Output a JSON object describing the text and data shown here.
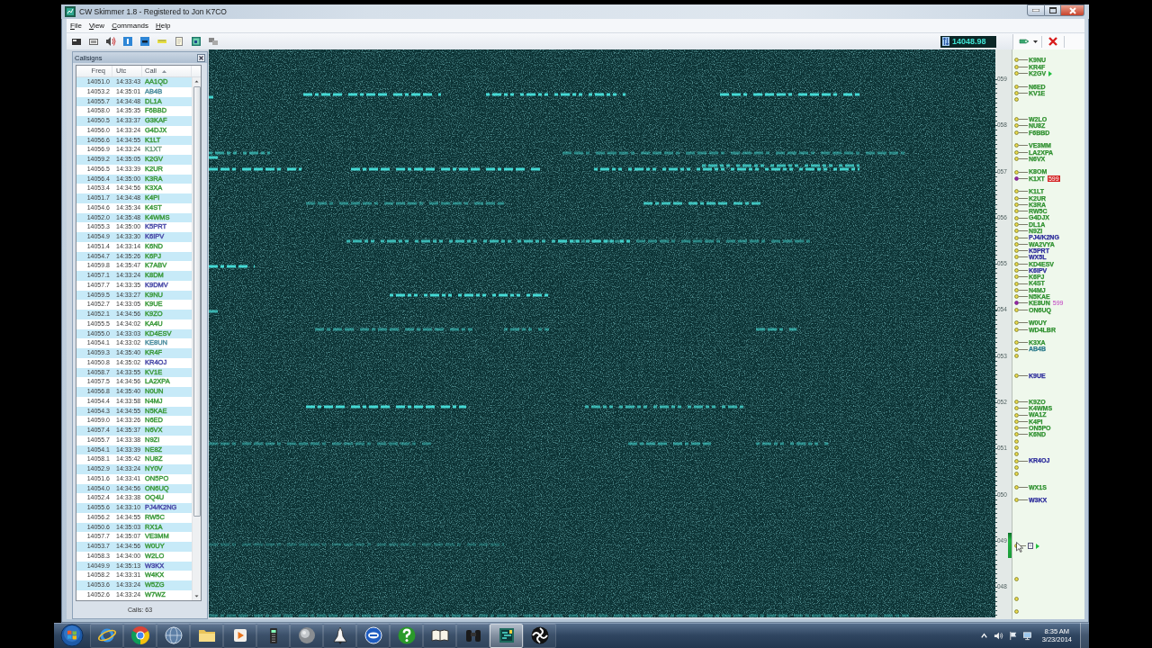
{
  "window": {
    "title": "CW Skimmer 1.8 - Registered to Jon K7CO"
  },
  "menu": [
    "File",
    "View",
    "Commands",
    "Help"
  ],
  "toolbar": {
    "frequency": "14048.98"
  },
  "callsigns": {
    "title": "Callsigns",
    "columns": [
      {
        "label": "Freq",
        "sorted": false
      },
      {
        "label": "Utc",
        "sorted": false
      },
      {
        "label": "Call",
        "sorted": true
      }
    ],
    "rows": [
      {
        "freq": "14051.0",
        "utc": "14:33:43",
        "call": "AA1QD",
        "color": "#3d9a3d"
      },
      {
        "freq": "14053.2",
        "utc": "14:35:01",
        "call": "AB4B",
        "color": "#4f8fa0"
      },
      {
        "freq": "14055.7",
        "utc": "14:34:48",
        "call": "DL1A",
        "color": "#3d9a3d"
      },
      {
        "freq": "14058.0",
        "utc": "14:35:35",
        "call": "F6BBD",
        "color": "#3d9a3d"
      },
      {
        "freq": "14050.5",
        "utc": "14:33:37",
        "call": "G3KAF",
        "color": "#3d9a3d"
      },
      {
        "freq": "14056.0",
        "utc": "14:33:24",
        "call": "G4DJX",
        "color": "#3d9a3d"
      },
      {
        "freq": "14056.6",
        "utc": "14:34:55",
        "call": "K1LT",
        "color": "#3d9a3d"
      },
      {
        "freq": "14056.9",
        "utc": "14:33:24",
        "call": "K1XT",
        "color": "#6f9f7f"
      },
      {
        "freq": "14059.2",
        "utc": "14:35:05",
        "call": "K2GV",
        "color": "#3d9a3d"
      },
      {
        "freq": "14056.5",
        "utc": "14:33:39",
        "call": "K2UR",
        "color": "#3d9a3d"
      },
      {
        "freq": "14056.4",
        "utc": "14:35:00",
        "call": "K3RA",
        "color": "#3d9a3d"
      },
      {
        "freq": "14053.4",
        "utc": "14:34:56",
        "call": "K3XA",
        "color": "#3d9a3d"
      },
      {
        "freq": "14051.7",
        "utc": "14:34:48",
        "call": "K4PI",
        "color": "#3d9a3d"
      },
      {
        "freq": "14054.6",
        "utc": "14:35:34",
        "call": "K4ST",
        "color": "#3d9a3d"
      },
      {
        "freq": "14052.0",
        "utc": "14:35:48",
        "call": "K4WMS",
        "color": "#3d9a3d"
      },
      {
        "freq": "14055.3",
        "utc": "14:35:00",
        "call": "K5PRT",
        "color": "#4a4aa8"
      },
      {
        "freq": "14054.9",
        "utc": "14:33:30",
        "call": "K6IPV",
        "color": "#4a4aa8"
      },
      {
        "freq": "14051.4",
        "utc": "14:33:14",
        "call": "K6ND",
        "color": "#3d9a3d"
      },
      {
        "freq": "14054.7",
        "utc": "14:35:26",
        "call": "K6PJ",
        "color": "#3d9a3d"
      },
      {
        "freq": "14059.8",
        "utc": "14:35:47",
        "call": "K7ABV",
        "color": "#3d9a3d"
      },
      {
        "freq": "14057.1",
        "utc": "14:33:24",
        "call": "K8DM",
        "color": "#3d9a3d"
      },
      {
        "freq": "14057.7",
        "utc": "14:33:35",
        "call": "K9DMV",
        "color": "#4a4aa8"
      },
      {
        "freq": "14059.5",
        "utc": "14:33:27",
        "call": "K9NU",
        "color": "#3d9a3d"
      },
      {
        "freq": "14052.7",
        "utc": "14:33:05",
        "call": "K9UE",
        "color": "#3d9a3d"
      },
      {
        "freq": "14052.1",
        "utc": "14:34:56",
        "call": "K9ZO",
        "color": "#3d9a3d"
      },
      {
        "freq": "14055.5",
        "utc": "14:34:02",
        "call": "KA4U",
        "color": "#3d9a3d"
      },
      {
        "freq": "14055.0",
        "utc": "14:33:03",
        "call": "KD4ESV",
        "color": "#3d9a3d"
      },
      {
        "freq": "14054.1",
        "utc": "14:33:02",
        "call": "KE8UN",
        "color": "#4f8fa0"
      },
      {
        "freq": "14059.3",
        "utc": "14:35:40",
        "call": "KR4F",
        "color": "#3d9a3d"
      },
      {
        "freq": "14050.8",
        "utc": "14:35:02",
        "call": "KR4OJ",
        "color": "#4a4aa8"
      },
      {
        "freq": "14058.7",
        "utc": "14:33:55",
        "call": "KV1E",
        "color": "#3d9a3d"
      },
      {
        "freq": "14057.5",
        "utc": "14:34:56",
        "call": "LA2XPA",
        "color": "#3d9a3d"
      },
      {
        "freq": "14056.8",
        "utc": "14:35:40",
        "call": "N0UN",
        "color": "#3d9a3d"
      },
      {
        "freq": "14054.4",
        "utc": "14:33:58",
        "call": "N4MJ",
        "color": "#3d9a3d"
      },
      {
        "freq": "14054.3",
        "utc": "14:34:55",
        "call": "N5KAE",
        "color": "#3d9a3d"
      },
      {
        "freq": "14059.0",
        "utc": "14:33:26",
        "call": "N6ED",
        "color": "#3d9a3d"
      },
      {
        "freq": "14057.4",
        "utc": "14:35:37",
        "call": "N6VX",
        "color": "#3d9a3d"
      },
      {
        "freq": "14055.7",
        "utc": "14:33:38",
        "call": "N9ZI",
        "color": "#3d9a3d"
      },
      {
        "freq": "14054.1",
        "utc": "14:33:39",
        "call": "NE8Z",
        "color": "#3d9a3d"
      },
      {
        "freq": "14058.1",
        "utc": "14:35:42",
        "call": "NU8Z",
        "color": "#3d9a3d"
      },
      {
        "freq": "14052.9",
        "utc": "14:33:24",
        "call": "NY0V",
        "color": "#3d9a3d"
      },
      {
        "freq": "14051.6",
        "utc": "14:33:41",
        "call": "ON5PO",
        "color": "#3d9a3d"
      },
      {
        "freq": "14054.0",
        "utc": "14:34:56",
        "call": "ON6UQ",
        "color": "#3d9a3d"
      },
      {
        "freq": "14052.4",
        "utc": "14:33:38",
        "call": "OQ4U",
        "color": "#3d9a3d"
      },
      {
        "freq": "14055.6",
        "utc": "14:33:10",
        "call": "PJ4/K2NG",
        "color": "#4a4aa8"
      },
      {
        "freq": "14056.2",
        "utc": "14:34:55",
        "call": "RW5C",
        "color": "#3d9a3d"
      },
      {
        "freq": "14050.6",
        "utc": "14:35:03",
        "call": "RX1A",
        "color": "#3d9a3d"
      },
      {
        "freq": "14057.7",
        "utc": "14:35:07",
        "call": "VE3MM",
        "color": "#3d9a3d"
      },
      {
        "freq": "14053.7",
        "utc": "14:34:56",
        "call": "W0UY",
        "color": "#3d9a3d"
      },
      {
        "freq": "14058.3",
        "utc": "14:34:00",
        "call": "W2LO",
        "color": "#3d9a3d"
      },
      {
        "freq": "14049.9",
        "utc": "14:35:13",
        "call": "W3KX",
        "color": "#4a4aa8"
      },
      {
        "freq": "14058.2",
        "utc": "14:33:31",
        "call": "W4KX",
        "color": "#3d9a3d"
      },
      {
        "freq": "14053.6",
        "utc": "14:33:24",
        "call": "W5ZG",
        "color": "#3d9a3d"
      },
      {
        "freq": "14052.6",
        "utc": "14:33:24",
        "call": "W7WZ",
        "color": "#3d9a3d"
      }
    ],
    "footer": "Calls: 63"
  },
  "band_map": {
    "scale": [
      "059",
      "058",
      "057",
      "056",
      "055",
      "054",
      "053",
      "052",
      "051",
      "050",
      "049",
      "048"
    ],
    "slots": [
      {
        "kind": "spot",
        "call": "K9NU",
        "color": "#2e902e",
        "highlighted": false,
        "arrow": false
      },
      {
        "kind": "spot",
        "call": "KR4F",
        "color": "#2e902e",
        "highlighted": false,
        "arrow": false
      },
      {
        "kind": "spot",
        "call": "K2GV",
        "color": "#2e902e",
        "highlighted": false,
        "arrow": true
      },
      {
        "kind": "blank"
      },
      {
        "kind": "spot",
        "call": "N6ED",
        "color": "#2e902e",
        "highlighted": false,
        "arrow": false
      },
      {
        "kind": "spot",
        "call": "KV1E",
        "color": "#2e902e",
        "highlighted": false,
        "arrow": false
      },
      {
        "kind": "marker"
      },
      {
        "kind": "blank"
      },
      {
        "kind": "blank"
      },
      {
        "kind": "spot",
        "call": "W2LO",
        "color": "#2e902e",
        "highlighted": false,
        "arrow": false
      },
      {
        "kind": "spot",
        "call": "NU8Z",
        "color": "#2e902e",
        "highlighted": false,
        "arrow": false
      },
      {
        "kind": "spot",
        "call": "F6BBD",
        "color": "#2e902e",
        "highlighted": false,
        "arrow": false
      },
      {
        "kind": "blank"
      },
      {
        "kind": "spot",
        "call": "VE3MM",
        "color": "#2e902e",
        "highlighted": false,
        "arrow": false
      },
      {
        "kind": "spot",
        "call": "LA2XPA",
        "color": "#2e902e",
        "highlighted": false,
        "arrow": false
      },
      {
        "kind": "spot",
        "call": "N6VX",
        "color": "#2e902e",
        "highlighted": false,
        "arrow": false
      },
      {
        "kind": "blank"
      },
      {
        "kind": "spot",
        "call": "K8OM",
        "color": "#2e902e",
        "highlighted": false,
        "arrow": false
      },
      {
        "kind": "spot",
        "call": "K1XT",
        "color": "#2e902e",
        "highlighted": true,
        "arrow": false,
        "report": {
          "text": "599",
          "boxed": true
        }
      },
      {
        "kind": "blank"
      },
      {
        "kind": "spot",
        "call": "K1LT",
        "color": "#2e902e",
        "highlighted": false,
        "arrow": false
      },
      {
        "kind": "spot",
        "call": "K2UR",
        "color": "#2e902e",
        "highlighted": false,
        "arrow": false
      },
      {
        "kind": "spot",
        "call": "K3RA",
        "color": "#2e902e",
        "highlighted": false,
        "arrow": false
      },
      {
        "kind": "spot",
        "call": "RW5C",
        "color": "#2e902e",
        "highlighted": false,
        "arrow": false
      },
      {
        "kind": "spot",
        "call": "G4DJX",
        "color": "#2e902e",
        "highlighted": false,
        "arrow": false
      },
      {
        "kind": "spot",
        "call": "DL1A",
        "color": "#2e902e",
        "highlighted": false,
        "arrow": false
      },
      {
        "kind": "spot",
        "call": "N9ZI",
        "color": "#2e902e",
        "highlighted": false,
        "arrow": false
      },
      {
        "kind": "spot",
        "call": "PJ4/K2NG",
        "color": "#2a2a9a",
        "highlighted": false,
        "arrow": false
      },
      {
        "kind": "spot",
        "call": "WA2VYA",
        "color": "#2e902e",
        "highlighted": false,
        "arrow": false
      },
      {
        "kind": "spot",
        "call": "K5PRT",
        "color": "#2a2a9a",
        "highlighted": false,
        "arrow": false
      },
      {
        "kind": "spot",
        "call": "WX5L",
        "color": "#2a2a9a",
        "highlighted": false,
        "arrow": false
      },
      {
        "kind": "spot",
        "call": "KD4ESV",
        "color": "#2e902e",
        "highlighted": false,
        "arrow": false
      },
      {
        "kind": "spot",
        "call": "K6IPV",
        "color": "#2a2a9a",
        "highlighted": false,
        "arrow": false
      },
      {
        "kind": "spot",
        "call": "K6PJ",
        "color": "#2e902e",
        "highlighted": false,
        "arrow": false
      },
      {
        "kind": "spot",
        "call": "K4ST",
        "color": "#2e902e",
        "highlighted": false,
        "arrow": false
      },
      {
        "kind": "spot",
        "call": "N4MJ",
        "color": "#2e902e",
        "highlighted": false,
        "arrow": false
      },
      {
        "kind": "spot",
        "call": "N5KAE",
        "color": "#2e902e",
        "highlighted": false,
        "arrow": false
      },
      {
        "kind": "spot",
        "call": "KE8UN",
        "color": "#2e902e",
        "highlighted": true,
        "arrow": false,
        "report": {
          "text": "599",
          "boxed": false
        }
      },
      {
        "kind": "spot",
        "call": "ON6UQ",
        "color": "#2e902e",
        "highlighted": false,
        "arrow": false
      },
      {
        "kind": "blank"
      },
      {
        "kind": "spot",
        "call": "W0UY",
        "color": "#2e902e",
        "highlighted": false,
        "arrow": false
      },
      {
        "kind": "spot",
        "call": "WD4LBR",
        "color": "#2e902e",
        "highlighted": false,
        "arrow": false
      },
      {
        "kind": "blank"
      },
      {
        "kind": "spot",
        "call": "K3XA",
        "color": "#2e902e",
        "highlighted": false,
        "arrow": false
      },
      {
        "kind": "spot",
        "call": "AB4B",
        "color": "#2a7a8a",
        "highlighted": false,
        "arrow": false
      },
      {
        "kind": "marker"
      },
      {
        "kind": "blank"
      },
      {
        "kind": "blank"
      },
      {
        "kind": "spot",
        "call": "K9UE",
        "color": "#2a2a9a",
        "highlighted": false,
        "arrow": false
      },
      {
        "kind": "blank"
      },
      {
        "kind": "blank"
      },
      {
        "kind": "blank"
      },
      {
        "kind": "spot",
        "call": "K9ZO",
        "color": "#2e902e",
        "highlighted": false,
        "arrow": false
      },
      {
        "kind": "spot",
        "call": "K4WMS",
        "color": "#2e902e",
        "highlighted": false,
        "arrow": false
      },
      {
        "kind": "spot",
        "call": "WA1Z",
        "color": "#2e902e",
        "highlighted": false,
        "arrow": false
      },
      {
        "kind": "spot",
        "call": "K4PI",
        "color": "#2e902e",
        "highlighted": false,
        "arrow": false
      },
      {
        "kind": "spot",
        "call": "ON5PO",
        "color": "#2e902e",
        "highlighted": false,
        "arrow": false
      },
      {
        "kind": "spot",
        "call": "K6ND",
        "color": "#2e902e",
        "highlighted": false,
        "arrow": false
      },
      {
        "kind": "marker"
      },
      {
        "kind": "marker"
      },
      {
        "kind": "marker"
      },
      {
        "kind": "spot",
        "call": "KR4OJ",
        "color": "#2a2a9a",
        "highlighted": false,
        "arrow": false
      },
      {
        "kind": "marker"
      },
      {
        "kind": "marker"
      },
      {
        "kind": "blank"
      },
      {
        "kind": "spot",
        "call": "WX1S",
        "color": "#2e902e",
        "highlighted": false,
        "arrow": false
      },
      {
        "kind": "blank"
      },
      {
        "kind": "spot",
        "call": "W3KX",
        "color": "#2a2a9a",
        "highlighted": false,
        "arrow": false
      },
      {
        "kind": "blank"
      },
      {
        "kind": "blank"
      },
      {
        "kind": "blank"
      },
      {
        "kind": "blank"
      },
      {
        "kind": "blank"
      },
      {
        "kind": "blank"
      },
      {
        "kind": "cursor"
      },
      {
        "kind": "blank"
      },
      {
        "kind": "blank"
      },
      {
        "kind": "blank"
      },
      {
        "kind": "blank"
      },
      {
        "kind": "marker"
      },
      {
        "kind": "blank"
      },
      {
        "kind": "blank"
      },
      {
        "kind": "marker"
      },
      {
        "kind": "blank"
      },
      {
        "kind": "marker"
      }
    ]
  },
  "taskbar": {
    "apps": [
      {
        "kind": "ring",
        "selected": false
      },
      {
        "kind": "wheel",
        "selected": false
      },
      {
        "kind": "globe",
        "selected": false
      },
      {
        "kind": "folder",
        "selected": false
      },
      {
        "kind": "player",
        "selected": false
      },
      {
        "kind": "radio",
        "selected": false
      },
      {
        "kind": "sphere",
        "selected": false
      },
      {
        "kind": "shuttle",
        "selected": false
      },
      {
        "kind": "disc",
        "selected": false
      },
      {
        "kind": "help",
        "selected": false
      },
      {
        "kind": "book",
        "selected": false
      },
      {
        "kind": "binoculars",
        "selected": false
      },
      {
        "kind": "skimmer",
        "selected": true
      },
      {
        "kind": "swirl",
        "selected": false
      }
    ],
    "time": "8:35 AM",
    "date": "3/23/2014"
  }
}
